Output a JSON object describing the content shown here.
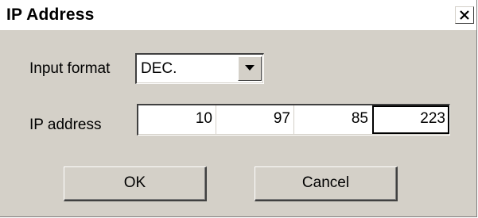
{
  "window": {
    "title": "IP Address",
    "close_icon": "close-icon"
  },
  "form": {
    "input_format_label": "Input format",
    "input_format_value": "DEC.",
    "dropdown_icon": "chevron-down-icon",
    "ip_address_label": "IP address",
    "ip_octets": [
      "10",
      "97",
      "85",
      "223"
    ]
  },
  "buttons": {
    "ok_label": "OK",
    "cancel_label": "Cancel"
  },
  "colors": {
    "dialog_background": "#d4d0c8",
    "field_background": "#ffffff",
    "text": "#000000"
  }
}
